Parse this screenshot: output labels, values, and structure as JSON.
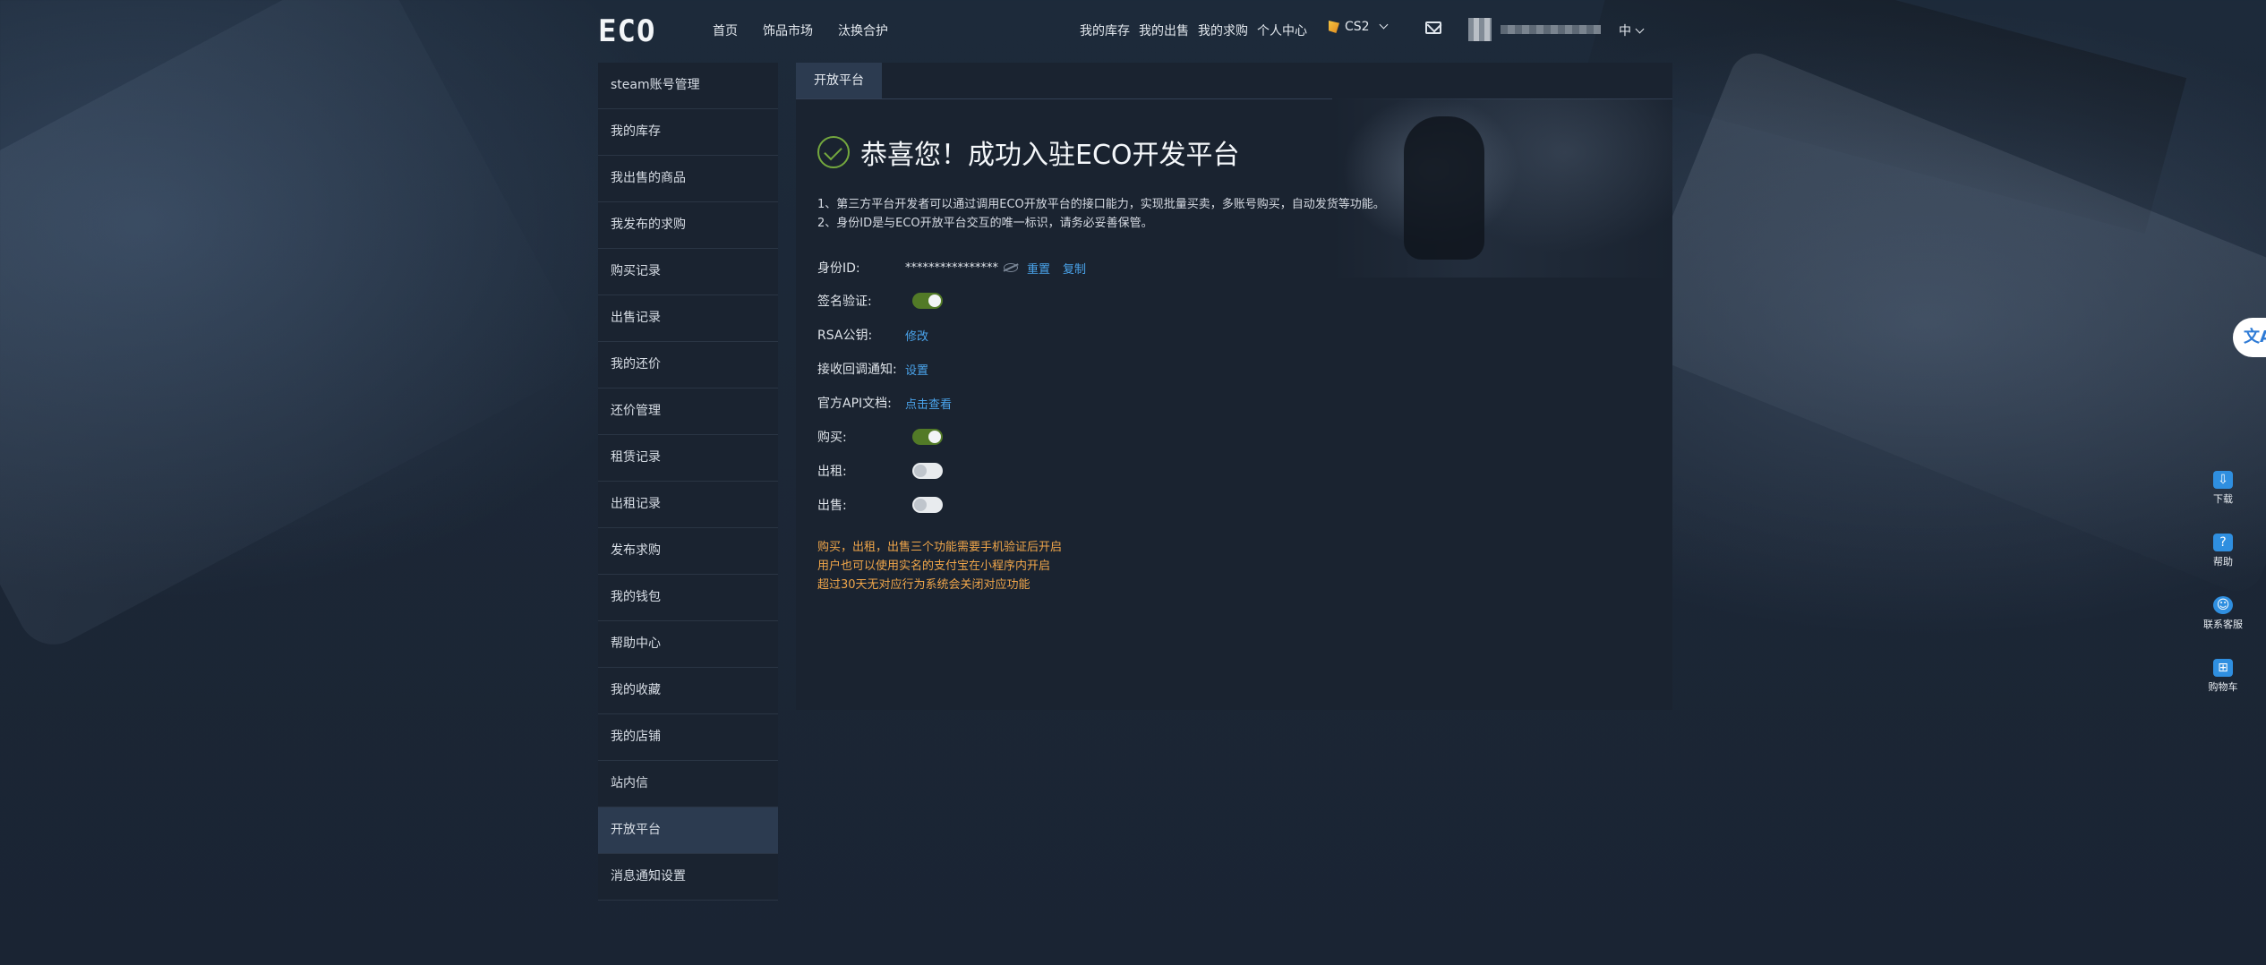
{
  "brand": {
    "logo": "ECO"
  },
  "nav": {
    "left": [
      "首页",
      "饰品市场",
      "汰换合护"
    ],
    "right": [
      "我的库存",
      "我的出售",
      "我的求购",
      "个人中心"
    ],
    "game": "CS2",
    "language": "中"
  },
  "sidebar": {
    "items": [
      "steam账号管理",
      "我的库存",
      "我出售的商品",
      "我发布的求购",
      "购买记录",
      "出售记录",
      "我的还价",
      "还价管理",
      "租赁记录",
      "出租记录",
      "发布求购",
      "我的钱包",
      "帮助中心",
      "我的收藏",
      "我的店铺",
      "站内信",
      "开放平台",
      "消息通知设置"
    ],
    "active": "开放平台"
  },
  "panel": {
    "tab": "开放平台",
    "title": "恭喜您！成功入驻ECO开发平台",
    "intro": [
      "1、第三方平台开发者可以通过调用ECO开放平台的接口能力，实现批量买卖，多账号购买，自动发货等功能。",
      "2、身份ID是与ECO开放平台交互的唯一标识，请务必妥善保管。"
    ],
    "identity": {
      "label": "身份ID:",
      "value": "****************",
      "reset": "重置",
      "copy": "复制"
    },
    "sign": {
      "label": "签名验证:",
      "state": "on"
    },
    "rsa": {
      "label": "RSA公钥:",
      "action": "修改"
    },
    "callback": {
      "label": "接收回调通知:",
      "action": "设置"
    },
    "api_docs": {
      "label": "官方API文档:",
      "action": "点击查看"
    },
    "buy": {
      "label": "购买:",
      "state": "on"
    },
    "rent": {
      "label": "出租:",
      "state": "off"
    },
    "sell": {
      "label": "出售:",
      "state": "off"
    },
    "notes": [
      "购买，出租，出售三个功能需要手机验证后开启",
      "用户也可以使用实名的支付宝在小程序内开启",
      "超过30天无对应行为系统会关闭对应功能"
    ]
  },
  "tools": {
    "translate": "文A",
    "items": [
      {
        "icon": "download-icon",
        "label": "下载"
      },
      {
        "icon": "help-icon",
        "label": "帮助"
      },
      {
        "icon": "support-icon",
        "label": "联系客服"
      },
      {
        "icon": "cart-icon",
        "label": "购物车"
      }
    ]
  },
  "colors": {
    "accent_link": "#4aa3ea",
    "success": "#74a83e",
    "toggle_on": "#527a27",
    "warning_text": "#f0a64a",
    "panel_bg": "#1a2330",
    "active_item": "#2c3b50"
  }
}
